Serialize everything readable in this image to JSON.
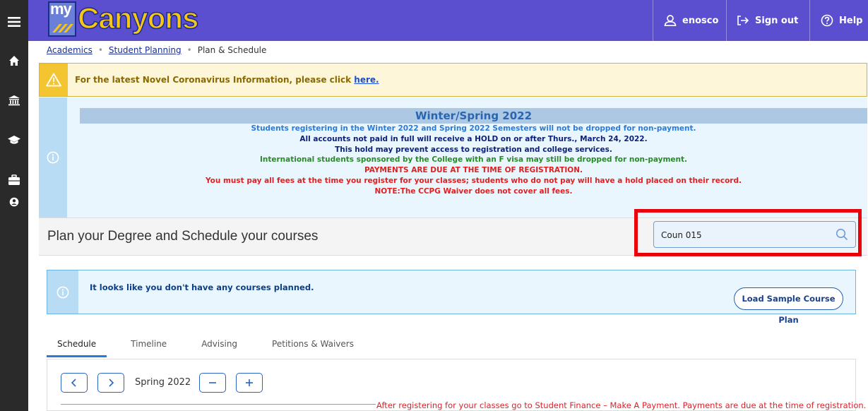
{
  "app": {
    "logo_prefix": "my",
    "logo_word": "Canyons"
  },
  "header": {
    "user": "enosco",
    "signout": "Sign out",
    "help": "Help"
  },
  "breadcrumb": {
    "items": [
      "Academics",
      "Student Planning"
    ],
    "current": "Plan & Schedule"
  },
  "alerts": {
    "covid_text": "For the latest Novel Coronavirus Information, please click ",
    "covid_link": "here."
  },
  "winter": {
    "title": "Winter/Spring 2022",
    "lines": [
      {
        "text": "Students registering in the Winter 2022 and Spring 2022 Semesters will not be dropped for non-payment.",
        "color": "#2a7ad6"
      },
      {
        "text": "All accounts not paid in full will receive a HOLD on or after Thurs., March 24, 2022.",
        "color": "#0b1f7a"
      },
      {
        "text": "This hold may prevent access to registration and college services.",
        "color": "#0b1f7a"
      },
      {
        "text": "International students sponsored by the College with an F visa may still be dropped for non-payment.",
        "color": "#2a8a2a"
      },
      {
        "text": "PAYMENTS ARE DUE AT THE TIME OF REGISTRATION.",
        "color": "#e02020"
      },
      {
        "text": "You must pay all fees at the time you register for your classes; students who do not pay will have a hold placed on their record.",
        "color": "#e02020"
      },
      {
        "text": "NOTE:The CCPG Waiver does not cover all fees.",
        "color": "#e02020"
      }
    ]
  },
  "plan": {
    "title": "Plan your Degree and Schedule your courses",
    "search_value": "Coun 015"
  },
  "nocourse": {
    "text": "It looks like you don't have any courses planned.",
    "button": "Load Sample Course Plan"
  },
  "tabs": [
    {
      "label": "Schedule",
      "active": true
    },
    {
      "label": "Timeline",
      "active": false
    },
    {
      "label": "Advising",
      "active": false
    },
    {
      "label": "Petitions & Waivers",
      "active": false
    }
  ],
  "schedule": {
    "term": "Spring 2022",
    "note": "After registering for your classes go to Student Finance – Make A Payment. Payments are due at the time of registration."
  },
  "colors": {
    "header": "#5b4fcf",
    "sidebar": "#2a2a2a",
    "highlight": "#e8000b",
    "accent": "#2a7ad6"
  }
}
